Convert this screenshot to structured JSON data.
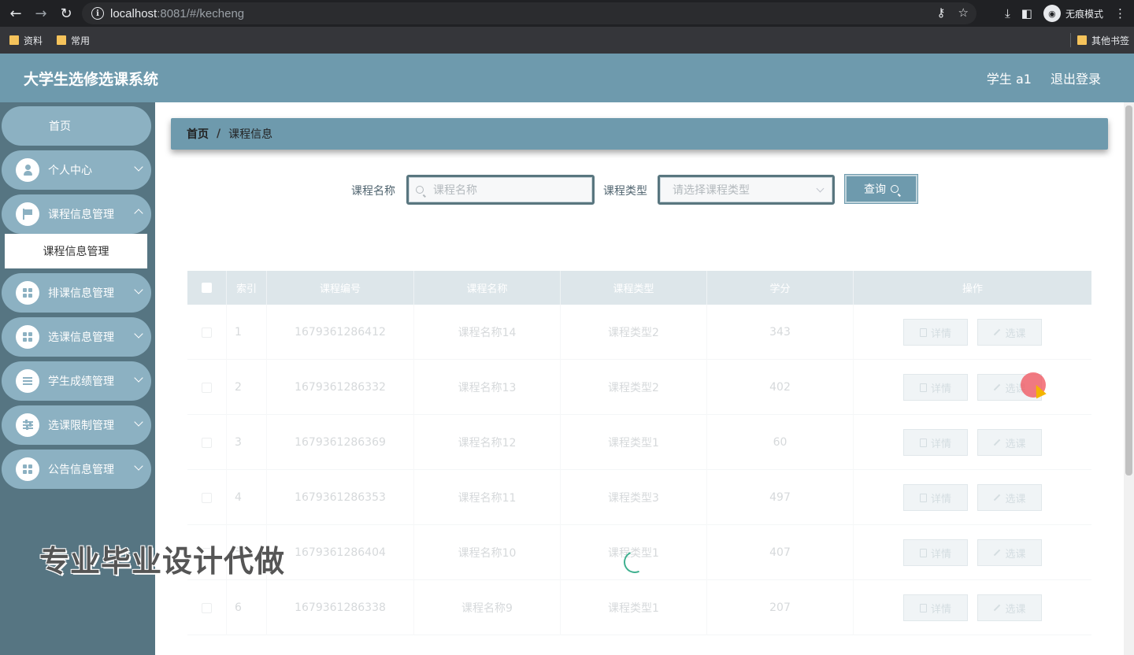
{
  "browser": {
    "url_host": "localhost",
    "url_rest": ":8081/#/kecheng",
    "incognito_label": "无痕模式",
    "bookmarks": [
      "资料",
      "常用"
    ],
    "other_bookmarks": "其他书签"
  },
  "header": {
    "title": "大学生选修选课系统",
    "user": "学生 a1",
    "logout": "退出登录"
  },
  "sidebar": {
    "home": "首页",
    "items": [
      {
        "label": "个人中心",
        "icon": "person-icon"
      },
      {
        "label": "课程信息管理",
        "icon": "flag-icon"
      },
      {
        "label": "排课信息管理",
        "icon": "grid-icon"
      },
      {
        "label": "选课信息管理",
        "icon": "grid-icon"
      },
      {
        "label": "学生成绩管理",
        "icon": "list-icon"
      },
      {
        "label": "选课限制管理",
        "icon": "sliders-icon"
      },
      {
        "label": "公告信息管理",
        "icon": "grid-icon"
      }
    ],
    "active_subitem": "课程信息管理"
  },
  "breadcrumb": {
    "home": "首页",
    "separator": "/",
    "current": "课程信息"
  },
  "search": {
    "name_label": "课程名称",
    "name_placeholder": "课程名称",
    "type_label": "课程类型",
    "type_placeholder": "请选择课程类型",
    "query_button": "查询"
  },
  "table": {
    "columns": [
      "索引",
      "课程编号",
      "课程名称",
      "课程类型",
      "学分",
      "操作"
    ],
    "detail_label": "详情",
    "select_label": "选课",
    "rows": [
      {
        "index": "1",
        "code": "1679361286412",
        "name": "课程名称14",
        "type": "课程类型2",
        "credit": "343"
      },
      {
        "index": "2",
        "code": "1679361286332",
        "name": "课程名称13",
        "type": "课程类型2",
        "credit": "402"
      },
      {
        "index": "3",
        "code": "1679361286369",
        "name": "课程名称12",
        "type": "课程类型1",
        "credit": "60"
      },
      {
        "index": "4",
        "code": "1679361286353",
        "name": "课程名称11",
        "type": "课程类型3",
        "credit": "497"
      },
      {
        "index": "5",
        "code": "1679361286404",
        "name": "课程名称10",
        "type": "课程类型1",
        "credit": "407"
      },
      {
        "index": "6",
        "code": "1679361286338",
        "name": "课程名称9",
        "type": "课程类型1",
        "credit": "207"
      }
    ]
  },
  "watermark": "专业毕业设计代做",
  "colors": {
    "header": "#6e9aad",
    "sidebar": "#567582",
    "menu_item": "#8cb1c2"
  }
}
